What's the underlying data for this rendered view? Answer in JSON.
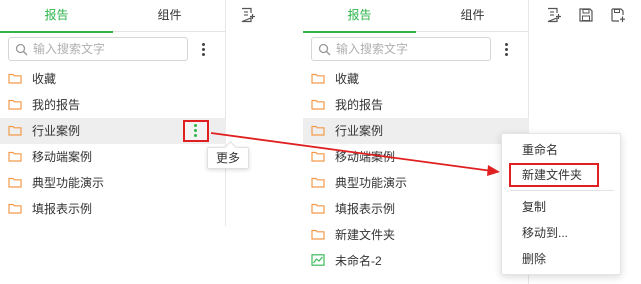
{
  "colors": {
    "accent": "#2db44b",
    "folder": "#f39a4a",
    "annotation": "#e02020"
  },
  "left_panel": {
    "tabs": [
      {
        "label": "报告",
        "active": true
      },
      {
        "label": "组件",
        "active": false
      }
    ],
    "search": {
      "placeholder": "输入搜索文字",
      "value": ""
    },
    "items": [
      {
        "label": "收藏",
        "icon": "folder-icon"
      },
      {
        "label": "我的报告",
        "icon": "folder-icon"
      },
      {
        "label": "行业案例",
        "icon": "folder-icon",
        "hovered": true
      },
      {
        "label": "移动端案例",
        "icon": "folder-icon"
      },
      {
        "label": "典型功能演示",
        "icon": "folder-icon"
      },
      {
        "label": "填报表示例",
        "icon": "folder-icon"
      }
    ],
    "tooltip": "更多"
  },
  "right_panel": {
    "tabs": [
      {
        "label": "报告",
        "active": true
      },
      {
        "label": "组件",
        "active": false
      }
    ],
    "search": {
      "placeholder": "输入搜索文字",
      "value": ""
    },
    "items": [
      {
        "label": "收藏",
        "icon": "folder-icon"
      },
      {
        "label": "我的报告",
        "icon": "folder-icon"
      },
      {
        "label": "行业案例",
        "icon": "folder-icon",
        "hovered": true
      },
      {
        "label": "移动端案例",
        "icon": "folder-icon"
      },
      {
        "label": "典型功能演示",
        "icon": "folder-icon"
      },
      {
        "label": "填报表示例",
        "icon": "folder-icon"
      },
      {
        "label": "新建文件夹",
        "icon": "folder-icon"
      },
      {
        "label": "未命名-2",
        "icon": "report-chart-icon"
      }
    ],
    "context_menu": {
      "items": [
        "重命名",
        "新建文件夹",
        "复制",
        "移动到...",
        "删除"
      ],
      "highlighted": "新建文件夹"
    }
  },
  "toolbar": {
    "left_icons": [
      "new-report-icon"
    ],
    "right_icons": [
      "new-report-icon",
      "save-icon",
      "save-as-icon"
    ]
  }
}
